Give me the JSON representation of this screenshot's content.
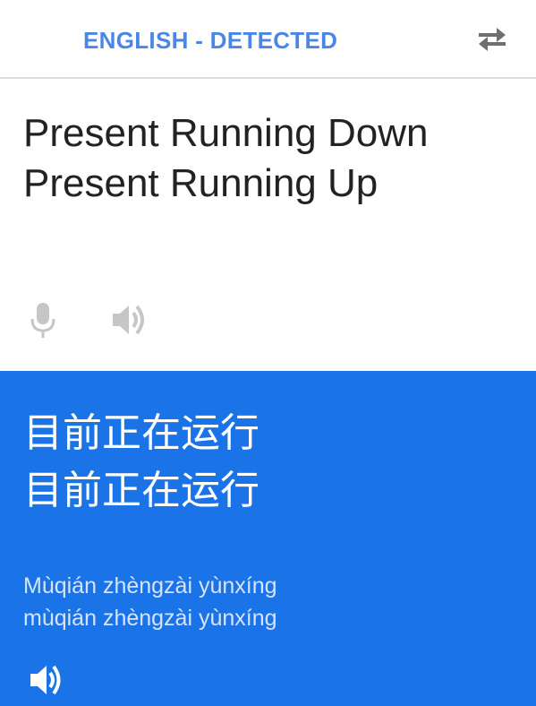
{
  "header": {
    "source_language": "ENGLISH - DETECTED",
    "swap_icon": "swap-languages-icon"
  },
  "source": {
    "lines": [
      "Present Running Down",
      "Present Running Up"
    ],
    "mic_icon": "microphone-icon",
    "speaker_icon": "speaker-icon"
  },
  "translation": {
    "lines": [
      "目前正在运行",
      "目前正在运行"
    ],
    "pinyin": [
      "Mùqián zhèngzài yùnxíng",
      "mùqián zhèngzài yùnxíng"
    ],
    "speaker_icon": "speaker-icon"
  },
  "colors": {
    "accent": "#4a86e8",
    "panel_background": "#1b73e8",
    "icon_gray": "#c6c6c6",
    "text_dark": "#222222"
  }
}
